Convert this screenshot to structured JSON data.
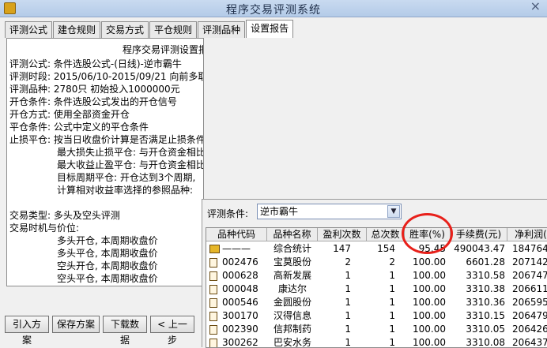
{
  "window": {
    "title": "程序交易评测系统",
    "close_glyph": "×"
  },
  "tabs": [
    {
      "label": "评测公式"
    },
    {
      "label": "建仓规则"
    },
    {
      "label": "交易方式"
    },
    {
      "label": "平仓规则"
    },
    {
      "label": "评测品种"
    },
    {
      "label": "设置报告"
    }
  ],
  "report": {
    "title": "程序交易评测设置报告",
    "lines": [
      "评测公式:  条件选股公式-(日线)-逆市霸牛",
      "评测时段:  2015/06/10-2015/09/21  向前多取100个数据用于计算  强制平仓计入收益",
      "评测品种:  2780只  初始投入1000000元",
      "开仓条件:  条件选股公式发出的开仓信号",
      "开仓方式:  使用全部资金开仓",
      "平仓条件:  公式中定义的平仓条件",
      "止损平仓:  按当日收盘价计算是否满足止损条件, 按本周期收盘价平仓",
      "最大损失止损平仓:  与开仓资金相比亏损达到3%, 则全部数量平仓",
      "最大收益止盈平仓:  与开仓资金相比收益达到10%, 则全部数量平仓",
      "目标周期平仓:  开仓达到3个周期,",
      "计算相对收益率选择的参照品种:",
      "交易类型:  多头及空头评测",
      "交易时机与价位:",
      "多头开仓, 本周期收盘价",
      "多头平仓, 本周期收盘价",
      "空头开仓, 本周期收盘价",
      "空头平仓, 本周期收盘价"
    ]
  },
  "buttons": {
    "import": "引入方案",
    "save": "保存方案",
    "download": "下载数据",
    "prev": "< 上一步"
  },
  "results": {
    "condition_label": "评测条件:",
    "condition_value": "逆市霸牛",
    "columns": [
      "品种代码",
      "品种名称",
      "盈利次数",
      "总次数",
      "胜率(%)",
      "手续费(元)",
      "净利润("
    ],
    "rows": [
      {
        "code": "———",
        "name": "综合统计",
        "wins": "147",
        "total": "154",
        "rate": "95.45",
        "fee": "490043.47",
        "profit": "1847644."
      },
      {
        "code": "002476",
        "name": "宝莫股份",
        "wins": "2",
        "total": "2",
        "rate": "100.00",
        "fee": "6601.28",
        "profit": "207142"
      },
      {
        "code": "000628",
        "name": "高新发展",
        "wins": "1",
        "total": "1",
        "rate": "100.00",
        "fee": "3310.58",
        "profit": "206747"
      },
      {
        "code": "000048",
        "name": "康达尔",
        "wins": "1",
        "total": "1",
        "rate": "100.00",
        "fee": "3310.38",
        "profit": "206611"
      },
      {
        "code": "000546",
        "name": "金圆股份",
        "wins": "1",
        "total": "1",
        "rate": "100.00",
        "fee": "3310.36",
        "profit": "206595"
      },
      {
        "code": "300170",
        "name": "汉得信息",
        "wins": "1",
        "total": "1",
        "rate": "100.00",
        "fee": "3310.15",
        "profit": "206479"
      },
      {
        "code": "002390",
        "name": "信邦制药",
        "wins": "1",
        "total": "1",
        "rate": "100.00",
        "fee": "3310.05",
        "profit": "206426"
      },
      {
        "code": "300262",
        "name": "巴安水务",
        "wins": "1",
        "total": "1",
        "rate": "100.00",
        "fee": "3310.08",
        "profit": "206437"
      }
    ]
  },
  "colors": {
    "highlight_circle": "#e8201a",
    "titlebar": "#b4cbe8"
  }
}
